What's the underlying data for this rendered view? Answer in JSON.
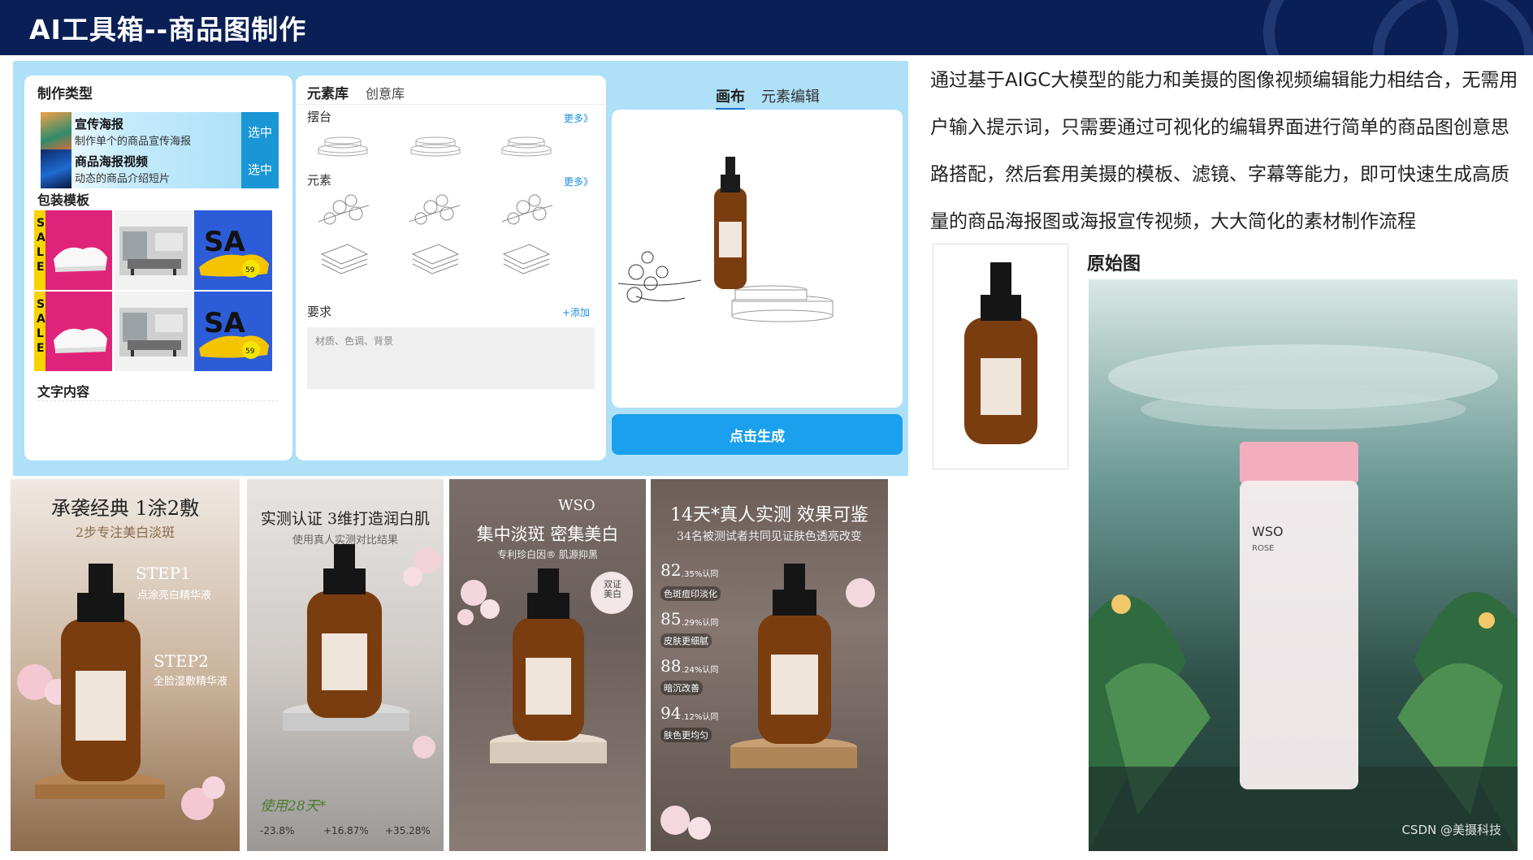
{
  "header": {
    "title": "AI工具箱--商品图制作"
  },
  "editor": {
    "type_panel": {
      "heading": "制作类型",
      "items": [
        {
          "title": "宣传海报",
          "desc": "制作单个的商品宣传海报",
          "button": "选中"
        },
        {
          "title": "商品海报视频",
          "desc": "动态的商品介绍短片",
          "button": "选中"
        }
      ],
      "template_heading": "包装模板",
      "text_heading": "文字内容"
    },
    "element_panel": {
      "tab_active": "元素库",
      "tab_other": "创意库",
      "stage_label": "摆台",
      "element_label": "元素",
      "more": "更多》",
      "requirement_label": "要求",
      "add": "+添加",
      "requirement_placeholder": "材质、色调、背景"
    },
    "canvas_panel": {
      "tab_active": "画布",
      "tab_other": "元素编辑",
      "generate_button": "点击生成"
    }
  },
  "description": "通过基于AIGC大模型的能力和美摄的图像视频编辑能力相结合，无需用户输入提示词，只需要通过可视化的编辑界面进行简单的商品图创意思路搭配，然后套用美摄的模板、滤镜、字幕等能力，即可快速生成高质量的商品海报图或海报宣传视频，大大简化的素材制作流程",
  "original_label": "原始图",
  "posters": [
    {
      "title": "承袭经典 1涂2敷",
      "subtitle": "2步专注美白淡斑",
      "step1": "STEP1",
      "step1_text": "点涂亮白精华液",
      "step2": "STEP2",
      "step2_text": "全脸湿敷精华液"
    },
    {
      "title": "实测认证 3维打造润白肌",
      "subtitle": "使用真人实测对比结果",
      "badge": "使用28天*",
      "stats": [
        "-23.8%",
        "+16.87%",
        "+35.28%"
      ]
    },
    {
      "brand": "WSO",
      "title": "集中淡斑 密集美白",
      "subtitle": "专利珍白因® 肌源抑黑",
      "seal": "双证美白"
    },
    {
      "title": "14天*真人实测 效果可鉴",
      "subtitle": "34名被测试者共同见证肤色透亮改变",
      "metrics": [
        {
          "num": "82",
          "pct": ".35%认同",
          "label": "色斑痘印淡化"
        },
        {
          "num": "85",
          "pct": ".29%认同",
          "label": "皮肤更细腻"
        },
        {
          "num": "88",
          "pct": ".24%认同",
          "label": "暗沉改善"
        },
        {
          "num": "94",
          "pct": ".12%认同",
          "label": "肤色更均匀"
        }
      ]
    }
  ],
  "water_product": {
    "brand": "WSO",
    "name": "ROSE"
  },
  "watermark": "CSDN @美摄科技",
  "colors": {
    "header_bg": "#0a1f55",
    "editor_bg": "#aee0f7",
    "accent": "#1aa0ec"
  }
}
